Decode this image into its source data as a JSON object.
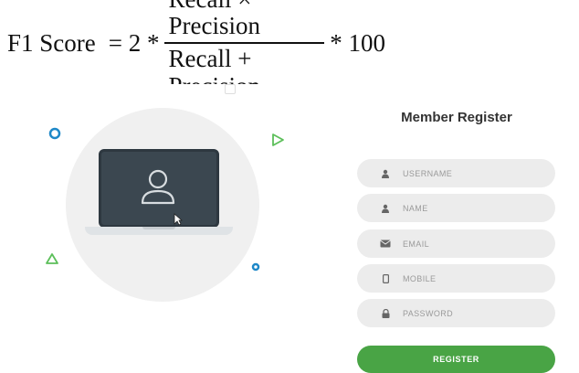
{
  "formula": {
    "lhs": "F1 Score",
    "eq_part": "= 2 *",
    "numerator": "Recall × Precision",
    "denominator": "Recall + Precision",
    "suffix": "* 100"
  },
  "form": {
    "title": "Member Register",
    "fields": [
      {
        "placeholder": "USERNAME",
        "icon": "user-icon"
      },
      {
        "placeholder": "NAME",
        "icon": "user-icon"
      },
      {
        "placeholder": "EMAIL",
        "icon": "envelope-icon"
      },
      {
        "placeholder": "MOBILE",
        "icon": "mobile-icon"
      },
      {
        "placeholder": "PASSWORD",
        "icon": "lock-icon"
      }
    ],
    "register_label": "REGISTER"
  },
  "colors": {
    "accent_green": "#49a445",
    "deco_blue": "#1e88c8",
    "deco_green": "#5cbf5a",
    "screen": "#3b4750",
    "field_bg": "#ececec"
  }
}
